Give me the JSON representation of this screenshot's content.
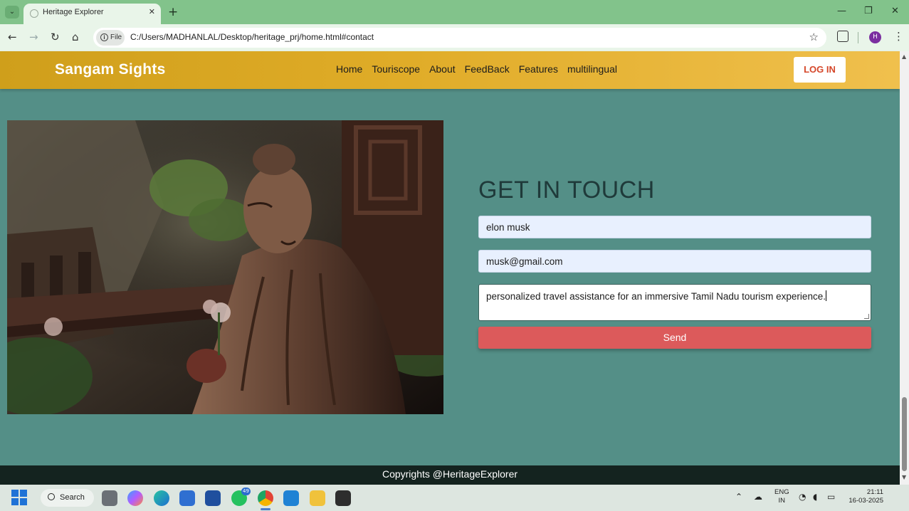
{
  "browser": {
    "tab_title": "Heritage Explorer",
    "address_chip": "File",
    "url": "C:/Users/MADHANLAL/Desktop/heritage_prj/home.html#contact",
    "profile_initial": "H"
  },
  "site": {
    "brand": "Sangam Sights",
    "nav": [
      "Home",
      "Touriscope",
      "About",
      "FeedBack",
      "Features",
      "multilingual"
    ],
    "login_label": "LOG IN"
  },
  "contact": {
    "title": "GET IN TOUCH",
    "name_value": "elon musk",
    "email_value": "musk@gmail.com",
    "message_value": "personalized travel assistance for an immersive Tamil Nadu tourism experience.",
    "send_label": "Send"
  },
  "footer": {
    "text": "Copyrights @HeritageExplorer"
  },
  "taskbar": {
    "search_label": "Search",
    "whatsapp_badge": "49",
    "lang_line1": "ENG",
    "lang_line2": "IN",
    "time": "21:11",
    "date": "16-03-2025"
  }
}
